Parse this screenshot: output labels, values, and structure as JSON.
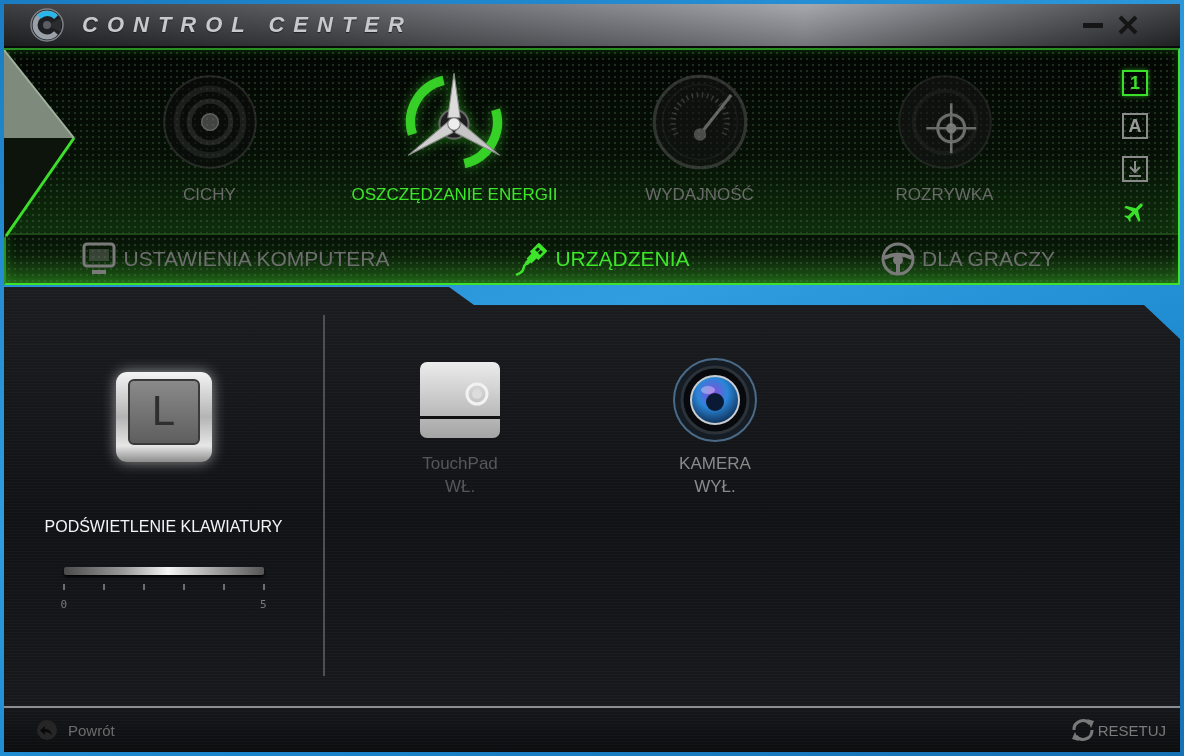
{
  "window": {
    "title": "CONTROL CENTER"
  },
  "power_modes": [
    {
      "label": "CICHY",
      "kind": "speaker",
      "selected": false
    },
    {
      "label": "OSZCZĘDZANIE ENERGII",
      "kind": "propeller",
      "selected": true
    },
    {
      "label": "WYDAJNOŚĆ",
      "kind": "gauge",
      "selected": false
    },
    {
      "label": "ROZRYWKA",
      "kind": "crosshair",
      "selected": false
    }
  ],
  "indicators": [
    {
      "kind": "key",
      "text": "1",
      "on": true
    },
    {
      "kind": "key",
      "text": "A",
      "on": false
    },
    {
      "kind": "download",
      "on": false
    },
    {
      "kind": "airplane",
      "on": true
    }
  ],
  "tabs": [
    {
      "label": "USTAWIENIA KOMPUTERA",
      "kind": "monitor",
      "selected": false
    },
    {
      "label": "URZĄDZENIA",
      "kind": "plug",
      "selected": true
    },
    {
      "label": "DLA GRACZY",
      "kind": "wheel",
      "selected": false
    }
  ],
  "keyboard_backlight": {
    "key_letter": "L",
    "label": "PODŚWIETLENIE KLAWIATURY",
    "scale_min": "0",
    "scale_max": "5"
  },
  "devices": [
    {
      "kind": "touchpad",
      "name": "TouchPad",
      "status": "WŁ.",
      "disabled": true
    },
    {
      "kind": "camera",
      "name": "KAMERA",
      "status": "WYŁ.",
      "disabled": false
    }
  ],
  "footer": {
    "back": "Powrót",
    "reset": "RESETUJ"
  }
}
